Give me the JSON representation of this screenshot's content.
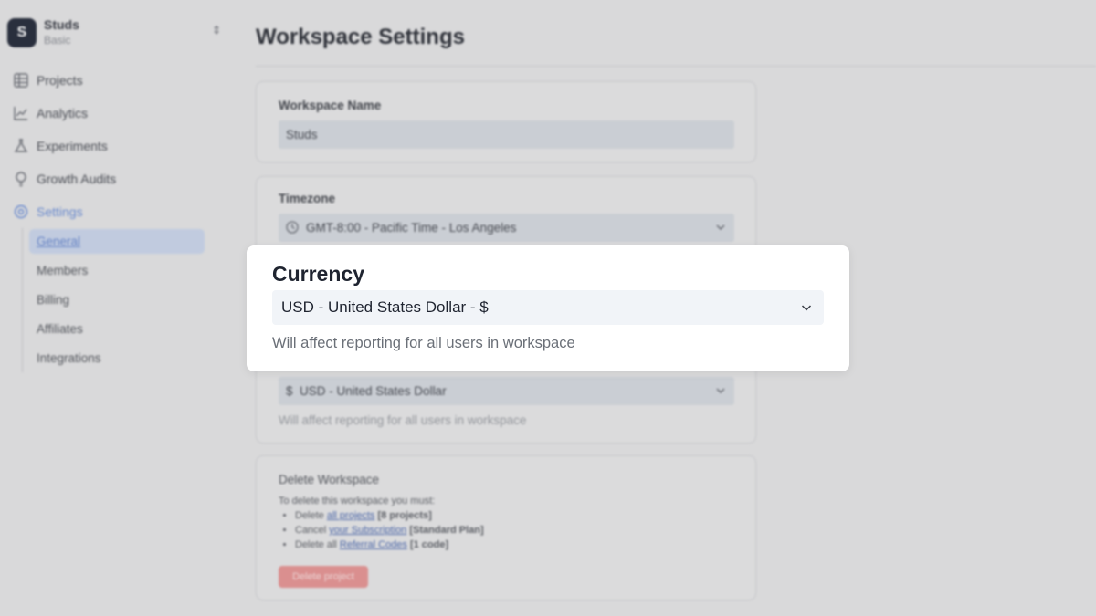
{
  "workspace": {
    "logo_letter": "S",
    "name": "Studs",
    "plan": "Basic"
  },
  "nav": [
    {
      "label": "Projects",
      "icon": "grid-icon"
    },
    {
      "label": "Analytics",
      "icon": "chart-line-icon"
    },
    {
      "label": "Experiments",
      "icon": "flask-icon"
    },
    {
      "label": "Growth Audits",
      "icon": "lightbulb-icon"
    },
    {
      "label": "Settings",
      "icon": "gear-icon",
      "active": true
    }
  ],
  "settings_subnav": [
    {
      "label": "General",
      "active": true
    },
    {
      "label": "Members"
    },
    {
      "label": "Billing"
    },
    {
      "label": "Affiliates"
    },
    {
      "label": "Integrations"
    }
  ],
  "page": {
    "title": "Workspace Settings",
    "workspace_name_label": "Workspace Name",
    "workspace_name_value": "Studs",
    "timezone_label": "Timezone",
    "timezone_value": "GMT-8:00 - Pacific Time - Los Angeles",
    "currency_value_bg": "$  USD - United States Dollar",
    "currency_helper_bg": "Will affect reporting for all users in workspace",
    "delete": {
      "title": "Delete Workspace",
      "intro": "To delete this workspace you must:",
      "items": [
        {
          "pre": "Delete ",
          "link": "all projects",
          "post": " [8 projects]"
        },
        {
          "pre": "Cancel ",
          "link": "your Subscription",
          "post": " [Standard Plan]"
        },
        {
          "pre": "Delete all ",
          "link": "Referral Codes",
          "post": " [1 code]"
        }
      ],
      "button": "Delete project"
    }
  },
  "focus": {
    "title": "Currency",
    "select_value": "USD - United States Dollar - $",
    "helper": "Will affect reporting for all users in workspace"
  },
  "colors": {
    "accent": "#6d8fd6",
    "danger": "#e39595",
    "focus_bg": "#ffffff"
  }
}
